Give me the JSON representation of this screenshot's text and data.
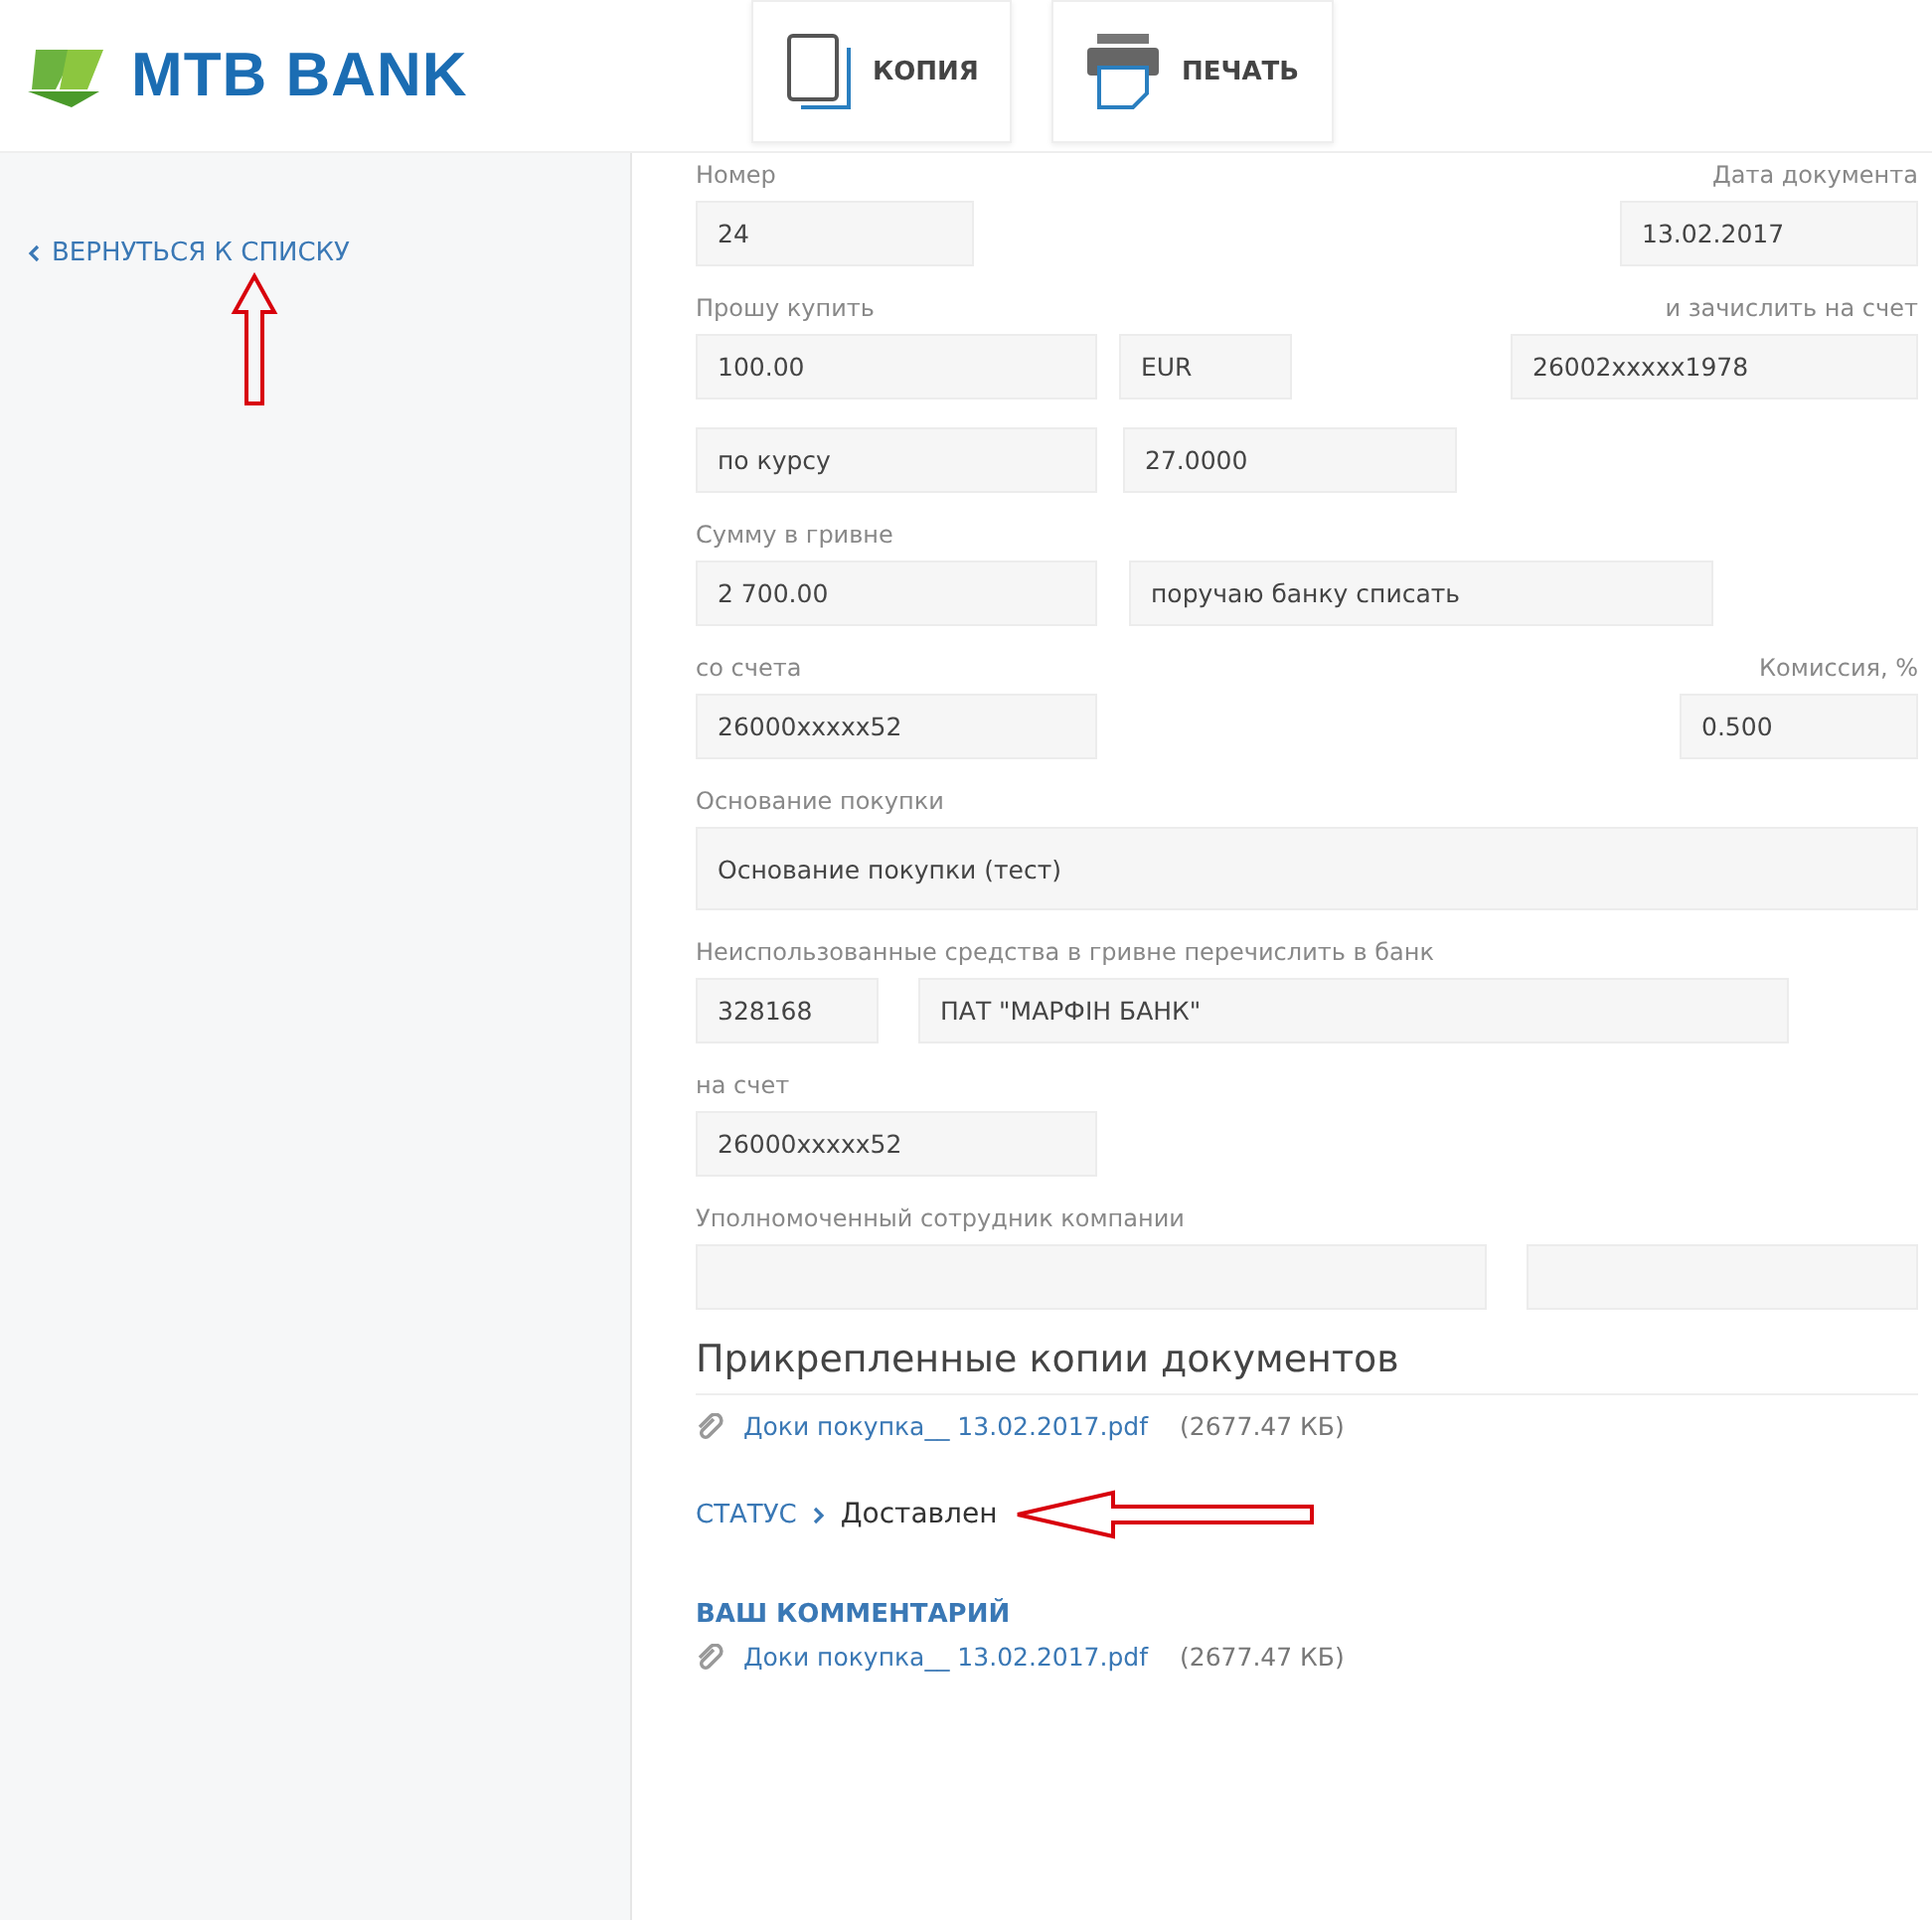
{
  "header": {
    "logo": "MTB BANK",
    "buttons": [
      {
        "label": "КОПИЯ",
        "kind": "copy"
      },
      {
        "label": "ПЕЧАТЬ",
        "kind": "print"
      }
    ]
  },
  "sidebar": {
    "back_link": "ВЕРНУТЬСЯ К СПИСКУ"
  },
  "form": {
    "rows": [
      {
        "labels": [
          "Номер",
          "Дата документа"
        ],
        "fields": [
          "24",
          "13.02.2017"
        ]
      },
      {
        "labels": [
          "Прошу купить",
          "и зачислить на счет"
        ],
        "fields": [
          "100.00",
          "EUR",
          "26002xxxxx1978"
        ]
      },
      {
        "fields": [
          "по курсу",
          "27.0000"
        ]
      },
      {
        "labels": [
          "Сумму в гривне"
        ],
        "fields": [
          "2 700.00",
          "поручаю банку списать"
        ]
      },
      {
        "labels": [
          "со счета",
          "Комиссия, %"
        ],
        "fields": [
          "26000xxxxx52",
          "0.500"
        ]
      },
      {
        "labels": [
          "Основание покупки"
        ],
        "fields": [
          "Основание покупки (тест)"
        ]
      },
      {
        "labels": [
          "Неиспользованные средства в гривне перечислить в банк"
        ],
        "fields": [
          "328168",
          "ПАТ \"МАРФІН БАНК\""
        ]
      },
      {
        "labels": [
          "на счет"
        ],
        "fields": [
          "26000xxxxx52"
        ]
      },
      {
        "labels": [
          "Уполномоченный сотрудник компании"
        ],
        "fields": [
          {
            "kind": "empty"
          },
          {
            "kind": "empty"
          }
        ]
      }
    ]
  },
  "attachments": {
    "title": "Прикрепленные копии документов",
    "files": [
      {
        "name": "Доки покупка__ 13.02.2017.pdf",
        "size": "(2677.47 КБ)"
      }
    ]
  },
  "status": {
    "label": "СТАТУС",
    "value": "Доставлен"
  },
  "comment": {
    "title": "ВАШ КОММЕНТАРИЙ",
    "files": [
      {
        "name": "Доки покупка__ 13.02.2017.pdf",
        "size": "(2677.47 КБ)"
      }
    ]
  }
}
